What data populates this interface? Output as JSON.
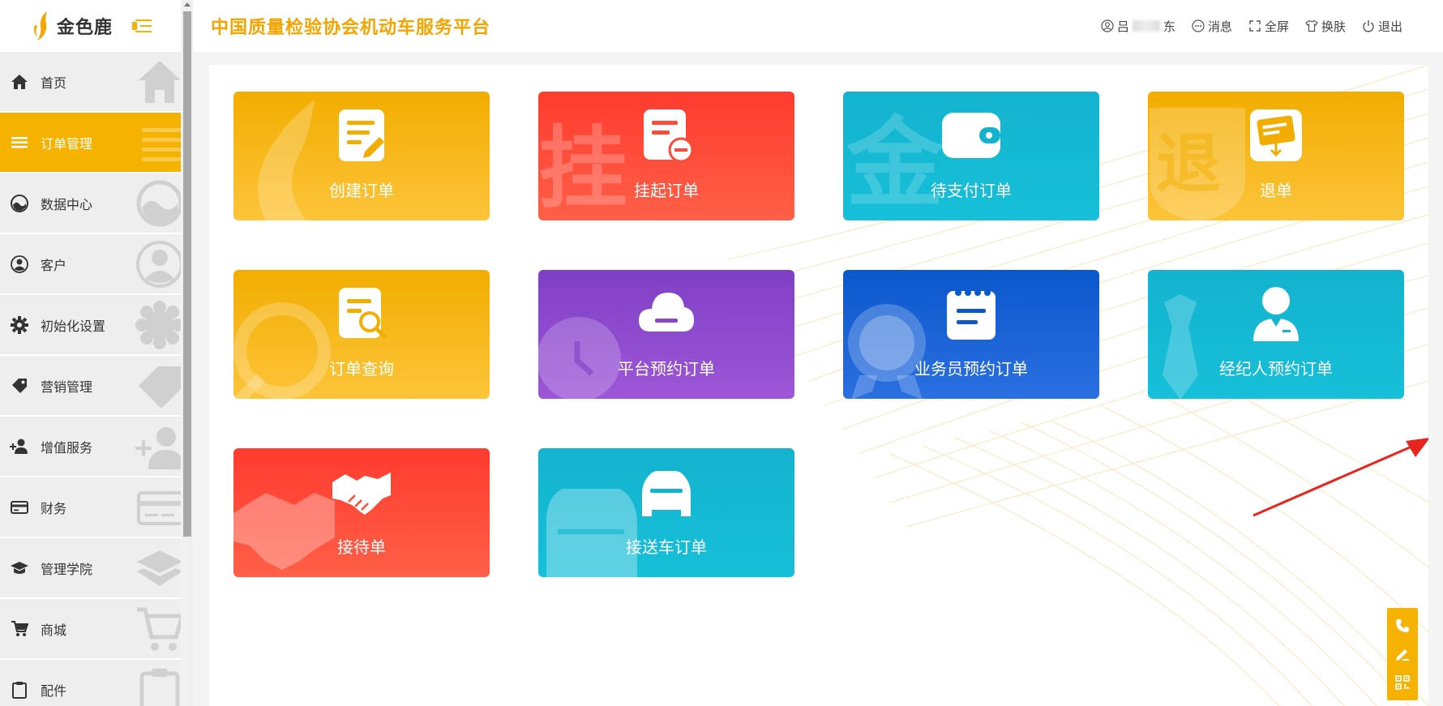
{
  "brand": {
    "name": "金色鹿",
    "accent": "#f5b200"
  },
  "header": {
    "title": "中国质量检验协会机动车服务平台",
    "user_prefix": "吕",
    "user_suffix": "东",
    "messages": "消息",
    "fullscreen": "全屏",
    "skin": "换肤",
    "logout": "退出"
  },
  "sidebar": {
    "items": [
      {
        "label": "首页",
        "icon": "home-icon",
        "active": false
      },
      {
        "label": "订单管理",
        "icon": "list-icon",
        "active": true
      },
      {
        "label": "数据中心",
        "icon": "chart-icon",
        "active": false
      },
      {
        "label": "客户",
        "icon": "person-icon",
        "active": false
      },
      {
        "label": "初始化设置",
        "icon": "gear-icon",
        "active": false
      },
      {
        "label": "营销管理",
        "icon": "tag-icon",
        "active": false
      },
      {
        "label": "增值服务",
        "icon": "add-user-icon",
        "active": false
      },
      {
        "label": "财务",
        "icon": "card-icon",
        "active": false
      },
      {
        "label": "管理学院",
        "icon": "graduation-cap-icon",
        "active": false
      },
      {
        "label": "商城",
        "icon": "cart-icon",
        "active": false
      },
      {
        "label": "配件",
        "icon": "clipboard-icon",
        "active": false
      }
    ]
  },
  "cards": [
    {
      "label": "创建订单",
      "color": "yellow",
      "icon": "edit-document-icon"
    },
    {
      "label": "挂起订单",
      "color": "red",
      "icon": "document-minus-icon",
      "watermark": "挂"
    },
    {
      "label": "待支付订单",
      "color": "teal",
      "icon": "wallet-icon",
      "watermark": "金"
    },
    {
      "label": "退单",
      "color": "yellow",
      "icon": "refund-icon",
      "watermark": "退"
    },
    {
      "label": "订单查询",
      "color": "yellow",
      "icon": "document-search-icon"
    },
    {
      "label": "平台预约订单",
      "color": "purple",
      "icon": "cloud-icon"
    },
    {
      "label": "业务员预约订单",
      "color": "blue",
      "icon": "notepad-icon"
    },
    {
      "label": "经纪人预约订单",
      "color": "teal",
      "icon": "agent-icon"
    },
    {
      "label": "接待单",
      "color": "red",
      "icon": "handshake-icon"
    },
    {
      "label": "接送车订单",
      "color": "teal",
      "icon": "car-icon"
    }
  ],
  "float_bar": [
    "phone-icon",
    "edit-icon",
    "qrcode-icon"
  ],
  "colors": {
    "annotation_arrow": "#e8241c"
  }
}
